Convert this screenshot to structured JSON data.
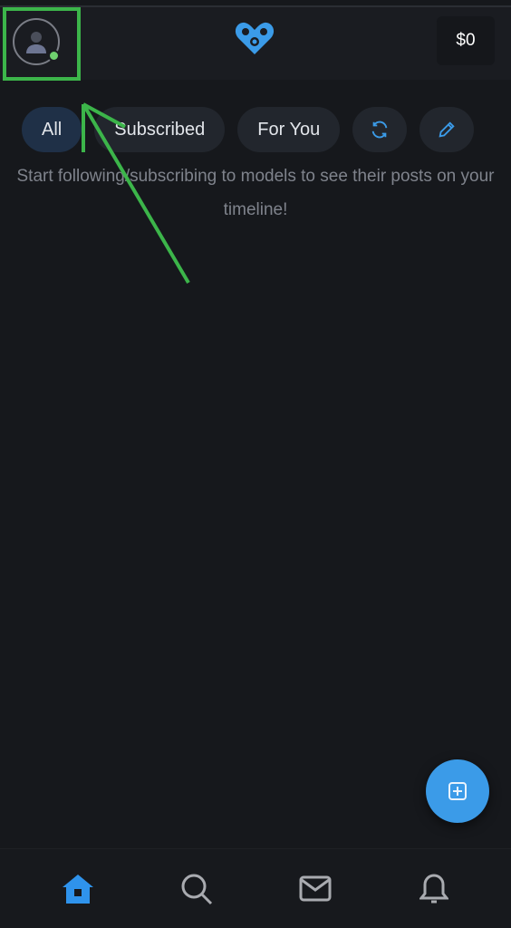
{
  "header": {
    "balance": "$0",
    "online_status_color": "#6fd06f",
    "logo_icon": "heart-lock-logo"
  },
  "tabs": [
    {
      "label": "All",
      "active": true
    },
    {
      "label": "Subscribed",
      "active": false
    },
    {
      "label": "For You",
      "active": false
    }
  ],
  "tab_icons": [
    "refresh-icon",
    "pencil-icon"
  ],
  "empty_message": "Start following/subscribing to models to see their posts on your timeline!",
  "fab_icon": "plus-square-icon",
  "bottom_nav": [
    "home-icon",
    "search-icon",
    "mail-icon",
    "bell-icon"
  ],
  "colors": {
    "accent": "#3b9be8",
    "background": "#16181c",
    "annotation": "#3cb54a"
  }
}
